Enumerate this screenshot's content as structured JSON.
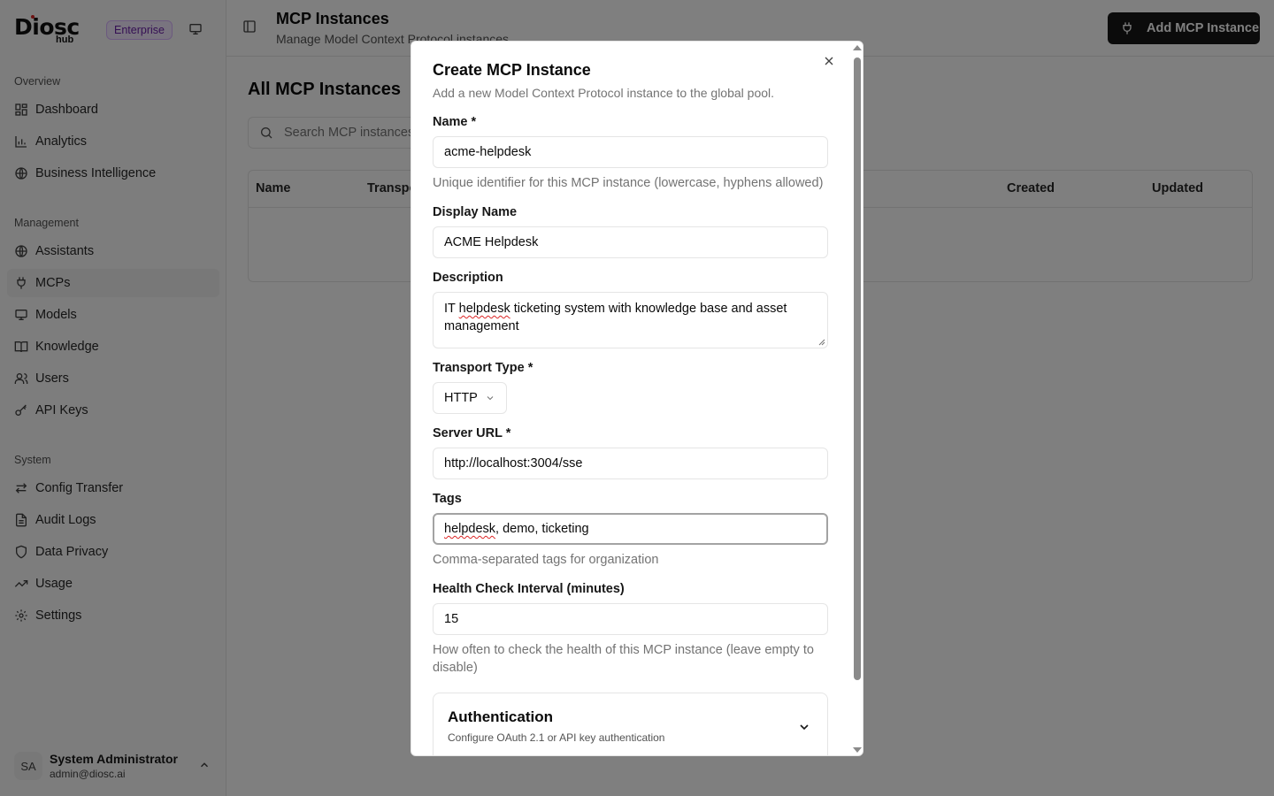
{
  "brand": {
    "name": "Diosc",
    "sub": "hub",
    "badge": "Enterprise"
  },
  "sidebar": {
    "sections": [
      {
        "heading": "Overview",
        "items": [
          {
            "label": "Dashboard",
            "icon": "layout-grid-icon"
          },
          {
            "label": "Analytics",
            "icon": "bar-chart-icon"
          },
          {
            "label": "Business Intelligence",
            "icon": "globe-icon"
          }
        ]
      },
      {
        "heading": "Management",
        "items": [
          {
            "label": "Assistants",
            "icon": "globe-icon"
          },
          {
            "label": "MCPs",
            "icon": "plug-icon",
            "active": true
          },
          {
            "label": "Models",
            "icon": "monitor-icon"
          },
          {
            "label": "Knowledge",
            "icon": "book-icon"
          },
          {
            "label": "Users",
            "icon": "users-icon"
          },
          {
            "label": "API Keys",
            "icon": "key-icon"
          }
        ]
      },
      {
        "heading": "System",
        "items": [
          {
            "label": "Config Transfer",
            "icon": "transfer-icon"
          },
          {
            "label": "Audit Logs",
            "icon": "file-text-icon"
          },
          {
            "label": "Data Privacy",
            "icon": "shield-icon"
          },
          {
            "label": "Usage",
            "icon": "trending-up-icon"
          },
          {
            "label": "Settings",
            "icon": "gear-icon"
          }
        ]
      }
    ],
    "user": {
      "initials": "SA",
      "name": "System Administrator",
      "email": "admin@diosc.ai"
    }
  },
  "header": {
    "title": "MCP Instances",
    "subtitle": "Manage Model Context Protocol instances",
    "add_button": "Add MCP Instance"
  },
  "content": {
    "section_title": "All MCP Instances",
    "search_placeholder": "Search MCP instances...",
    "columns": [
      "Name",
      "Transport",
      "Created",
      "Updated"
    ]
  },
  "dialog": {
    "title": "Create MCP Instance",
    "description": "Add a new Model Context Protocol instance to the global pool.",
    "name_label": "Name *",
    "name_value": "acme-helpdesk",
    "name_hint": "Unique identifier for this MCP instance (lowercase, hyphens allowed)",
    "display_label": "Display Name",
    "display_value": "ACME Helpdesk",
    "desc_label": "Description",
    "desc_pre": "IT ",
    "desc_err": "helpdesk",
    "desc_post": " ticketing system with knowledge base and asset management",
    "transport_label": "Transport Type *",
    "transport_value": "HTTP",
    "url_label": "Server URL *",
    "url_value": "http://localhost:3004/sse",
    "tags_label": "Tags",
    "tags_err": "helpdesk",
    "tags_post": ", demo, ticketing",
    "tags_hint": "Comma-separated tags for organization",
    "health_label": "Health Check Interval (minutes)",
    "health_value": "15",
    "health_hint": "How often to check the health of this MCP instance (leave empty to disable)",
    "auth_title": "Authentication",
    "auth_sub": "Configure OAuth 2.1 or API key authentication"
  }
}
